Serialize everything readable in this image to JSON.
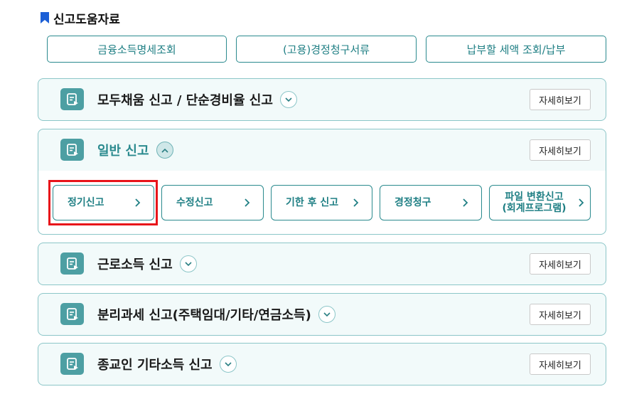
{
  "section": {
    "title": "신고도움자료"
  },
  "top_buttons": [
    {
      "label": "금융소득명세조회"
    },
    {
      "label": "(고용)경정청구서류"
    },
    {
      "label": "납부할 세액 조회/납부"
    }
  ],
  "detail_label": "자세히보기",
  "cards": [
    {
      "title": "모두채움 신고 / 단순경비율 신고",
      "expanded": false
    },
    {
      "title": "일반 신고",
      "expanded": true,
      "sub_buttons": [
        {
          "label": "정기신고"
        },
        {
          "label": "수정신고"
        },
        {
          "label": "기한 후 신고"
        },
        {
          "label": "경정청구"
        },
        {
          "label_line1": "파일 변환신고",
          "label_line2": "(회계프로그램)"
        }
      ]
    },
    {
      "title": "근로소득 신고",
      "expanded": false
    },
    {
      "title": "분리과세 신고(주택임대/기타/연금소득)",
      "expanded": false
    },
    {
      "title": "종교인 기타소득 신고",
      "expanded": false
    }
  ],
  "colors": {
    "accent": "#2a8a8e",
    "card_bg": "#f2fafa",
    "card_border": "#8cc6c8",
    "highlight": "#e8141a"
  }
}
